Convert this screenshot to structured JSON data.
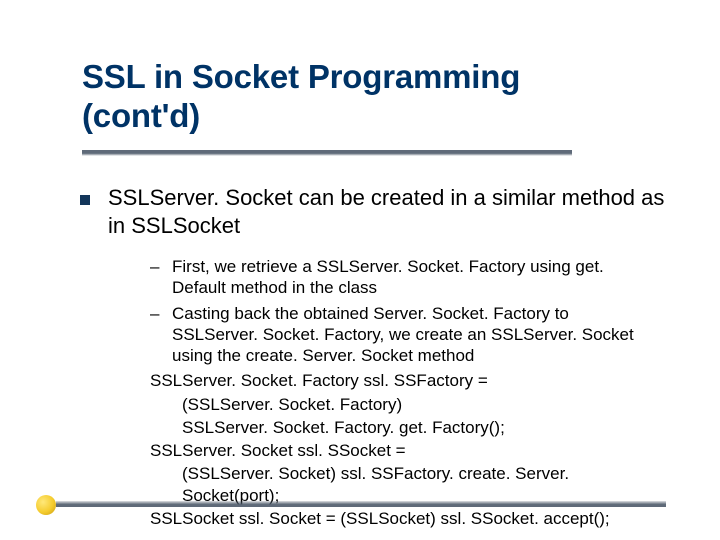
{
  "title": "SSL in Socket Programming (cont'd)",
  "main": "SSLServer. Socket can be created in a similar method as in SSLSocket",
  "sub1": "First, we retrieve a SSLServer. Socket. Factory using get. Default method in the class",
  "sub2": "Casting back the obtained Server. Socket. Factory to SSLServer. Socket. Factory, we create an SSLServer. Socket using the create. Server. Socket method",
  "code1a": "SSLServer. Socket. Factory ssl. SSFactory =",
  "code1b": "(SSLServer. Socket. Factory)",
  "code1c": "SSLServer. Socket. Factory. get. Factory();",
  "code2a": "SSLServer. Socket ssl. SSocket =",
  "code2b": "(SSLServer. Socket) ssl. SSFactory. create. Server. Socket(port);",
  "code3": "SSLSocket ssl. Socket = (SSLSocket) ssl. SSocket. accept();"
}
